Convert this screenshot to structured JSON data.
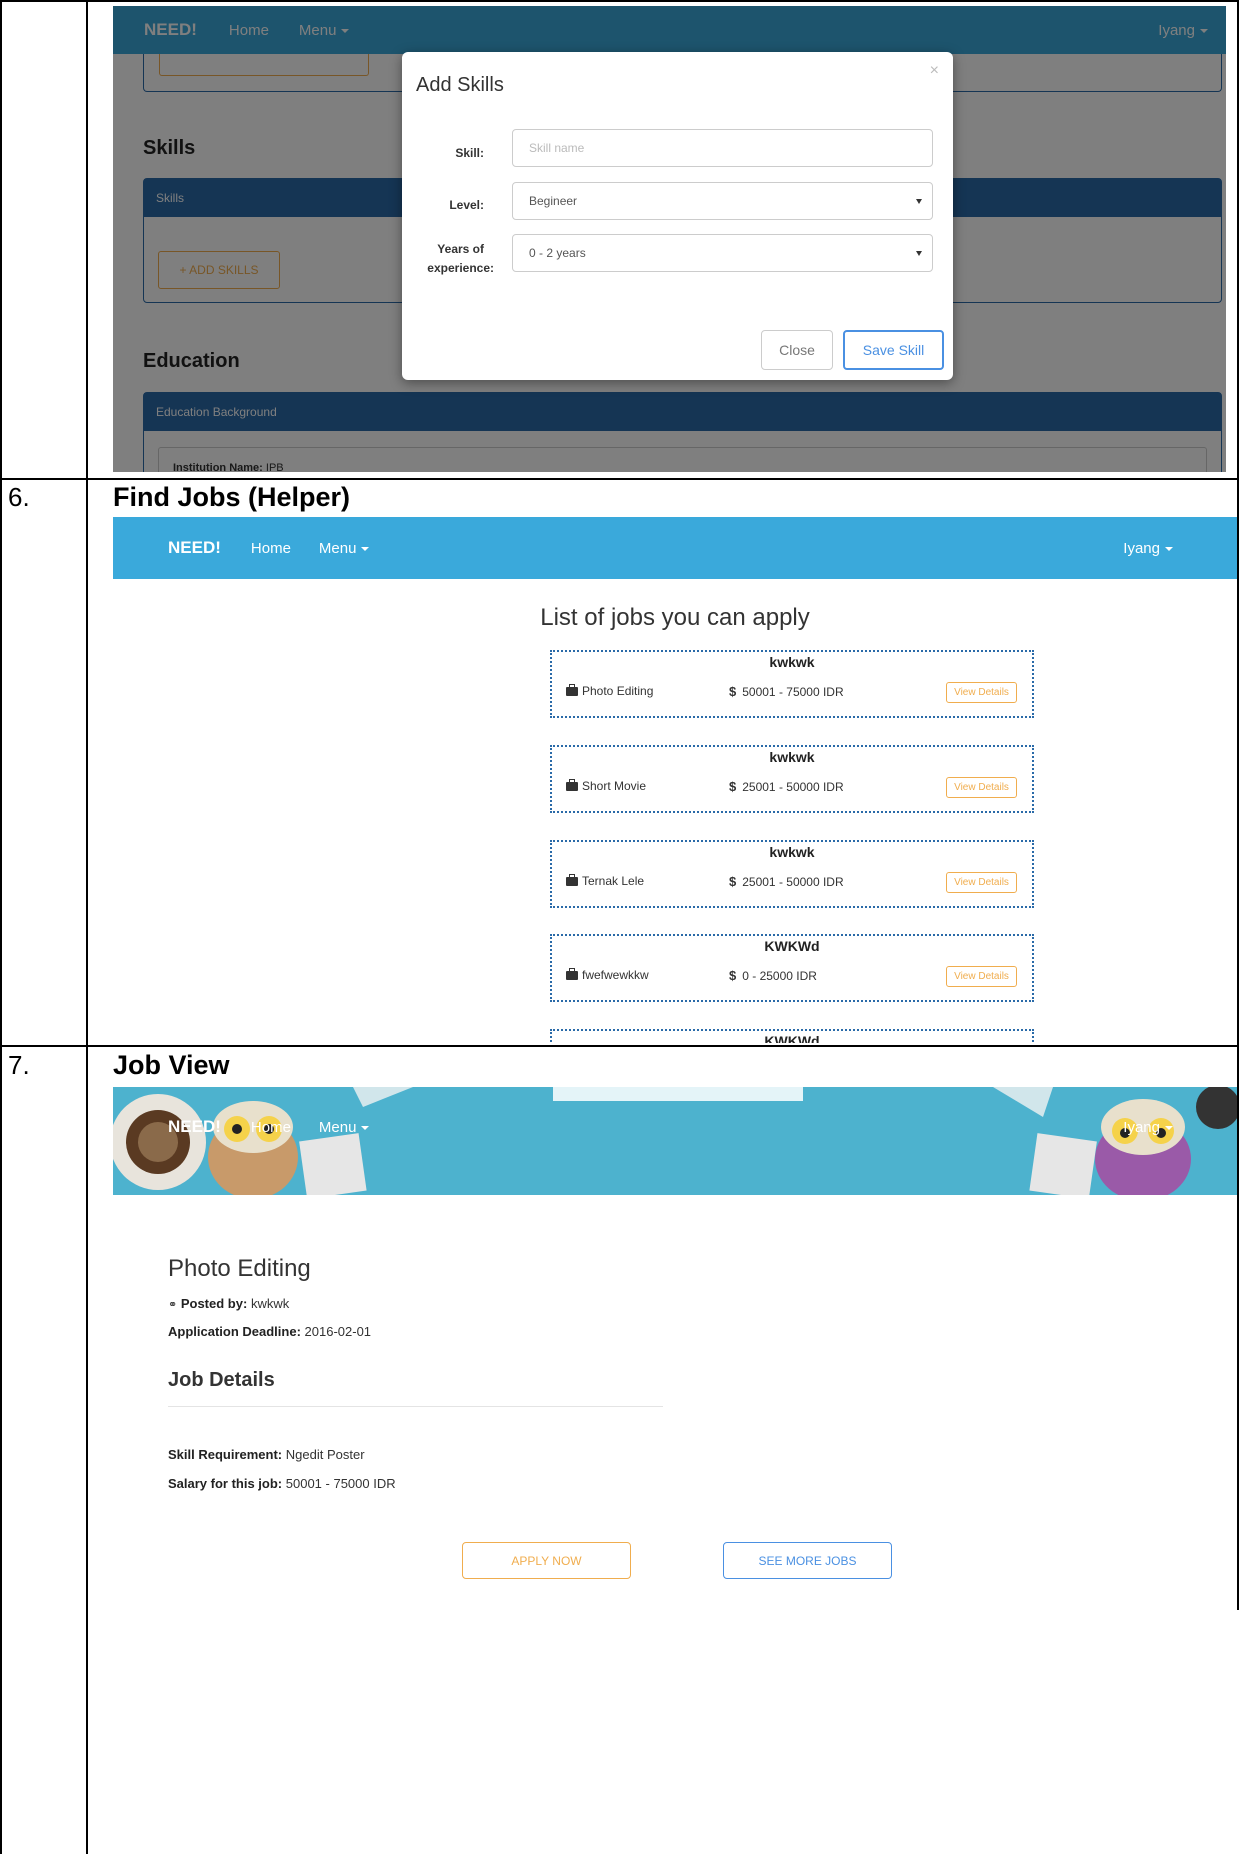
{
  "rows": [
    {
      "number": "",
      "title": ""
    },
    {
      "number": "6.",
      "title": "Find Jobs (Helper)"
    },
    {
      "number": "7.",
      "title": "Job View"
    }
  ],
  "shot1": {
    "nav": {
      "brand": "NEED!",
      "home": "Home",
      "menu": "Menu",
      "user": "Iyang"
    },
    "sections": {
      "skills_heading": "Skills",
      "skills_panel": "Skills",
      "add_skills": "+ ADD SKILLS",
      "education_heading": "Education",
      "education_panel": "Education Background",
      "institution_label": "Institution Name:",
      "institution_value": "IPB"
    },
    "modal": {
      "title": "Add Skills",
      "close_glyph": "×",
      "skill_label": "Skill:",
      "skill_placeholder": "Skill name",
      "level_label": "Level:",
      "level_value": "Begineer",
      "years_label_1": "Years of",
      "years_label_2": "experience:",
      "years_value": "0 - 2 years",
      "close_button": "Close",
      "save_button": "Save Skill"
    }
  },
  "shot2": {
    "nav": {
      "brand": "NEED!",
      "home": "Home",
      "menu": "Menu",
      "user": "Iyang"
    },
    "heading": "List of jobs you can apply",
    "view_details": "View Details",
    "jobs": [
      {
        "title": "kwkwk",
        "skill": "Photo Editing",
        "salary": "50001 - 75000 IDR"
      },
      {
        "title": "kwkwk",
        "skill": "Short Movie",
        "salary": "25001 - 50000 IDR"
      },
      {
        "title": "kwkwk",
        "skill": "Ternak Lele",
        "salary": "25001 - 50000 IDR"
      },
      {
        "title": "KWKWd",
        "skill": "fwefwewkkw",
        "salary": "0 - 25000 IDR"
      },
      {
        "title": "KWKWd"
      }
    ]
  },
  "shot3": {
    "nav": {
      "brand": "NEED!",
      "home": "Home",
      "menu": "Menu",
      "user": "Iyang"
    },
    "job_title": "Photo Editing",
    "posted_by_label": "Posted by:",
    "posted_by_value": "kwkwk",
    "deadline_label": "Application Deadline:",
    "deadline_value": "2016-02-01",
    "details_heading": "Job Details",
    "skill_req_label": "Skill Requirement:",
    "skill_req_value": "Ngedit Poster",
    "salary_label": "Salary for this job:",
    "salary_value": "50001 - 75000 IDR",
    "apply_button": "APPLY NOW",
    "more_jobs_button": "SEE MORE JOBS"
  },
  "colors": {
    "nav_blue": "#3aa9db",
    "panel_blue": "#2a6aa8",
    "orange": "#f0ad4e",
    "save_blue": "#4a90e2"
  }
}
